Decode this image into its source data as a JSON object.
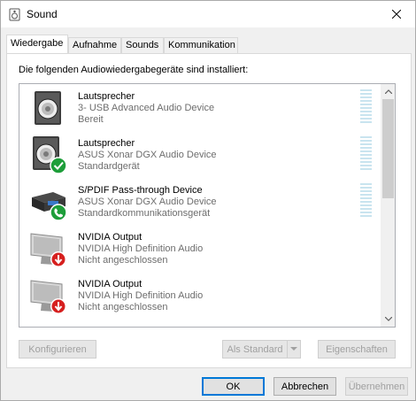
{
  "window": {
    "title": "Sound"
  },
  "tabs": [
    {
      "label": "Wiedergabe",
      "active": true
    },
    {
      "label": "Aufnahme",
      "active": false
    },
    {
      "label": "Sounds",
      "active": false
    },
    {
      "label": "Kommunikation",
      "active": false
    }
  ],
  "panel": {
    "heading": "Die folgenden Audiowiedergabegeräte sind installiert:"
  },
  "devices": [
    {
      "name": "Lautsprecher",
      "driver": "3- USB Advanced Audio Device",
      "status": "Bereit",
      "icon": "speaker-icon",
      "badge": "none"
    },
    {
      "name": "Lautsprecher",
      "driver": "ASUS Xonar DGX Audio Device",
      "status": "Standardgerät",
      "icon": "speaker-icon",
      "badge": "green-check-icon"
    },
    {
      "name": "S/PDIF Pass-through Device",
      "driver": "ASUS Xonar DGX Audio Device",
      "status": "Standardkommunikationsgerät",
      "icon": "spdif-device-icon",
      "badge": "green-phone-icon"
    },
    {
      "name": "NVIDIA Output",
      "driver": "NVIDIA High Definition Audio",
      "status": "Nicht angeschlossen",
      "icon": "monitor-icon",
      "badge": "red-down-arrow-icon"
    },
    {
      "name": "NVIDIA Output",
      "driver": "NVIDIA High Definition Audio",
      "status": "Nicht angeschlossen",
      "icon": "monitor-icon",
      "badge": "red-down-arrow-icon"
    }
  ],
  "buttons": {
    "configure": "Konfigurieren",
    "set_default": "Als Standard",
    "properties": "Eigenschaften",
    "ok": "OK",
    "cancel": "Abbrechen",
    "apply": "Übernehmen"
  },
  "colors": {
    "accent": "#0078d7",
    "meter": "#c9e4ef",
    "check": "#1e9e3a",
    "alert": "#d6201f"
  }
}
